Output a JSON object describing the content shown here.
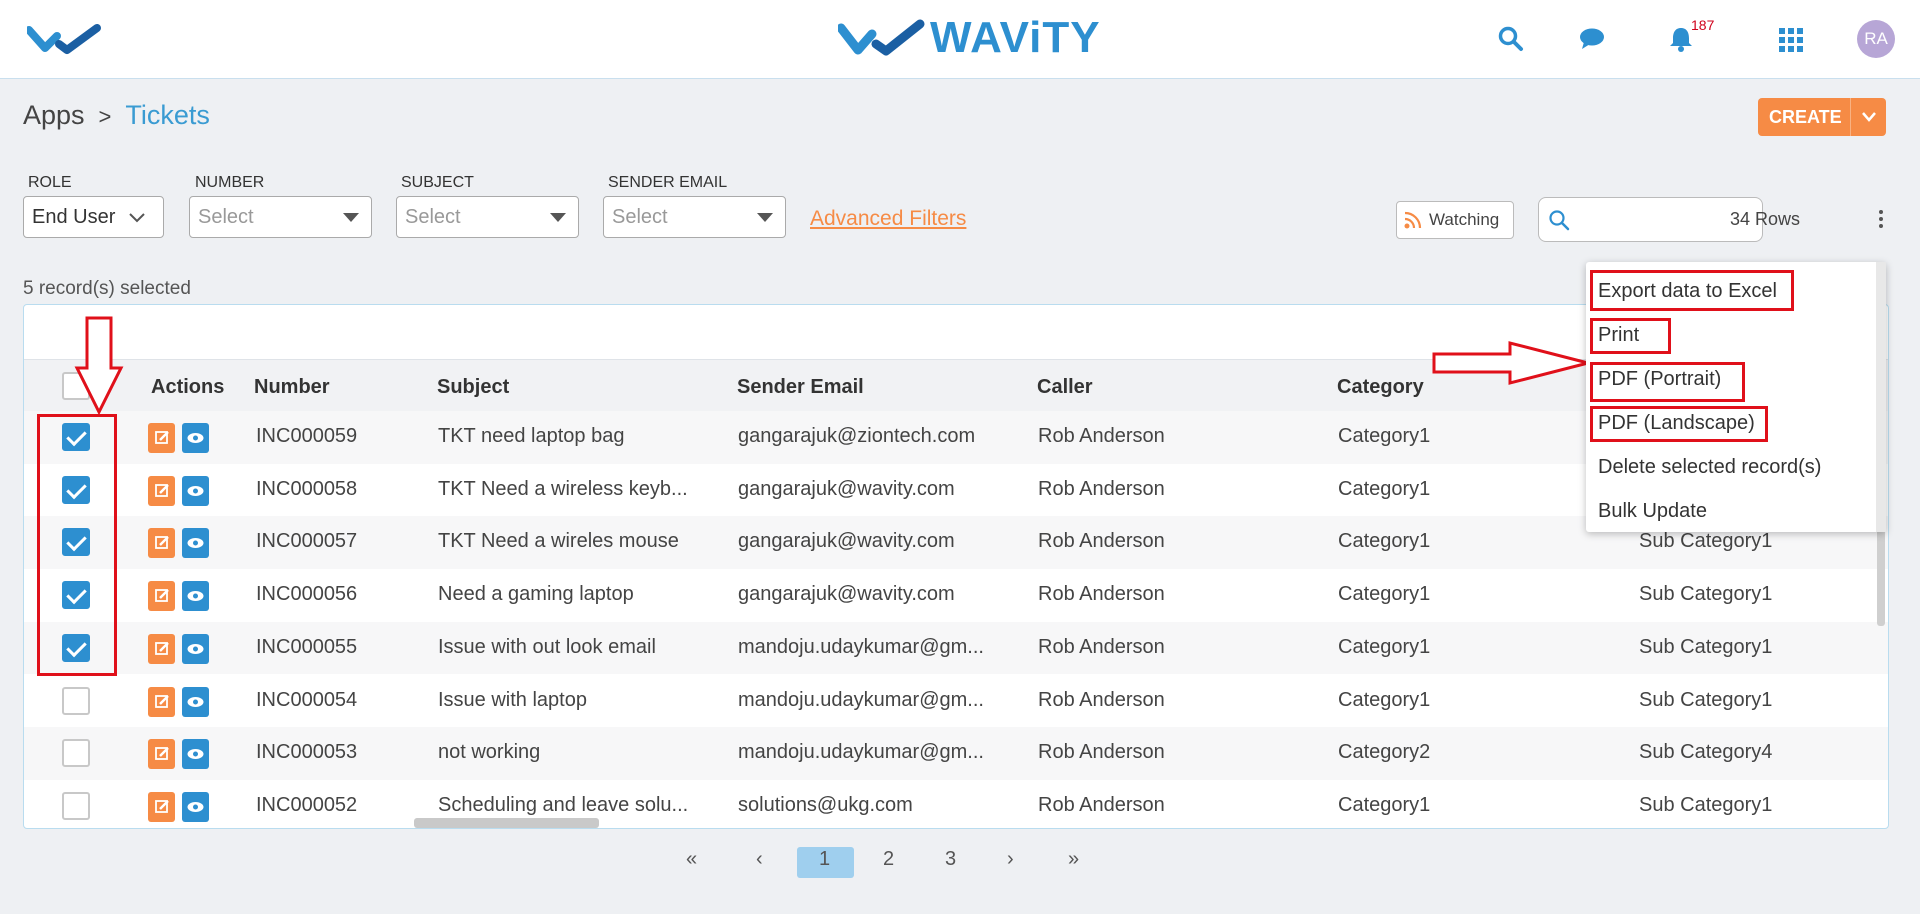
{
  "header": {
    "brand": "WAViTY",
    "notification_count": "187",
    "avatar_initials": "RA"
  },
  "breadcrumb": {
    "root": "Apps",
    "separator": ">",
    "current": "Tickets"
  },
  "create_button": {
    "label": "CREATE"
  },
  "filters": {
    "role": {
      "label": "ROLE",
      "value": "End User"
    },
    "number": {
      "label": "NUMBER",
      "placeholder": "Select"
    },
    "subject": {
      "label": "SUBJECT",
      "placeholder": "Select"
    },
    "sender_email": {
      "label": "SENDER EMAIL",
      "placeholder": "Select"
    },
    "advanced": "Advanced Filters"
  },
  "toolbar": {
    "watching": "Watching",
    "rows": "34 Rows"
  },
  "selection_text": "5 record(s) selected",
  "table": {
    "headers": [
      "Actions",
      "Number",
      "Subject",
      "Sender Email",
      "Caller",
      "Category"
    ],
    "rows": [
      {
        "checked": true,
        "number": "INC000059",
        "subject": "TKT need laptop bag",
        "email": "gangarajuk@ziontech.com",
        "caller": "Rob Anderson",
        "category": "Category1",
        "subcategory": ""
      },
      {
        "checked": true,
        "number": "INC000058",
        "subject": "TKT Need a wireless keyb...",
        "email": "gangarajuk@wavity.com",
        "caller": "Rob Anderson",
        "category": "Category1",
        "subcategory": ""
      },
      {
        "checked": true,
        "number": "INC000057",
        "subject": "TKT Need a wireles mouse",
        "email": "gangarajuk@wavity.com",
        "caller": "Rob Anderson",
        "category": "Category1",
        "subcategory": "Sub Category1"
      },
      {
        "checked": true,
        "number": "INC000056",
        "subject": "Need a gaming laptop",
        "email": "gangarajuk@wavity.com",
        "caller": "Rob Anderson",
        "category": "Category1",
        "subcategory": "Sub Category1"
      },
      {
        "checked": true,
        "number": "INC000055",
        "subject": "Issue with out look email",
        "email": "mandoju.udaykumar@gm...",
        "caller": "Rob Anderson",
        "category": "Category1",
        "subcategory": "Sub Category1"
      },
      {
        "checked": false,
        "number": "INC000054",
        "subject": "Issue with laptop",
        "email": "mandoju.udaykumar@gm...",
        "caller": "Rob Anderson",
        "category": "Category1",
        "subcategory": "Sub Category1"
      },
      {
        "checked": false,
        "number": "INC000053",
        "subject": "not working",
        "email": "mandoju.udaykumar@gm...",
        "caller": "Rob Anderson",
        "category": "Category2",
        "subcategory": "Sub Category4"
      },
      {
        "checked": false,
        "number": "INC000052",
        "subject": "Scheduling and leave solu...",
        "email": "solutions@ukg.com",
        "caller": "Rob Anderson",
        "category": "Category1",
        "subcategory": "Sub Category1"
      }
    ]
  },
  "menu": {
    "items": [
      "Export data to Excel",
      "Print",
      "PDF (Portrait)",
      "PDF (Landscape)",
      "Delete selected record(s)",
      "Bulk Update"
    ]
  },
  "pagination": {
    "first": "«",
    "prev": "‹",
    "pages": [
      "1",
      "2",
      "3"
    ],
    "current": "1",
    "next": "›",
    "last": "»"
  },
  "colors": {
    "accent": "#2d8fd0",
    "orange": "#f68b45",
    "annotation": "#e0101a"
  }
}
